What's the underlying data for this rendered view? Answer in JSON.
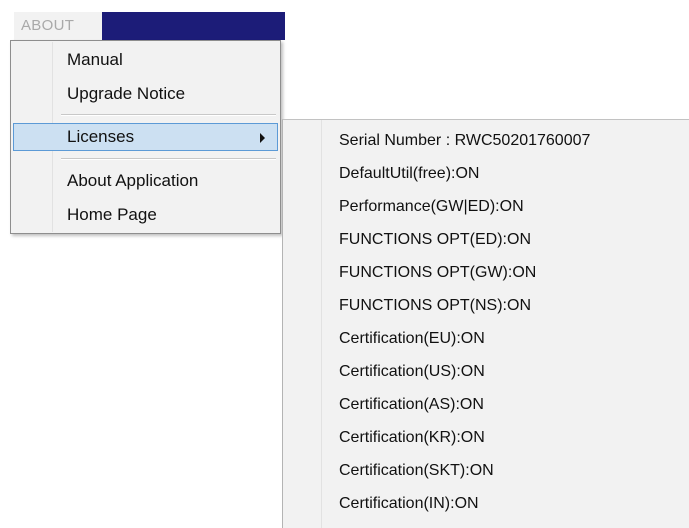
{
  "menubar": {
    "title": "ABOUT"
  },
  "menu": {
    "items": [
      {
        "label": "Manual"
      },
      {
        "label": "Upgrade Notice"
      },
      {
        "label": "Licenses"
      },
      {
        "label": "About Application"
      },
      {
        "label": "Home Page"
      }
    ],
    "submenu_arrow_icon": "triangle-right-icon"
  },
  "licenses_submenu": {
    "items": [
      {
        "label": "Serial Number : RWC50201760007"
      },
      {
        "label": "DefaultUtil(free):ON"
      },
      {
        "label": "Performance(GW|ED):ON"
      },
      {
        "label": "FUNCTIONS OPT(ED):ON"
      },
      {
        "label": "FUNCTIONS OPT(GW):ON"
      },
      {
        "label": "FUNCTIONS OPT(NS):ON"
      },
      {
        "label": "Certification(EU):ON"
      },
      {
        "label": "Certification(US):ON"
      },
      {
        "label": "Certification(AS):ON"
      },
      {
        "label": "Certification(KR):ON"
      },
      {
        "label": "Certification(SKT):ON"
      },
      {
        "label": "Certification(IN):ON"
      }
    ]
  },
  "colors": {
    "menubar_bg": "#1c1c78",
    "highlight_bg": "#cce0f2",
    "highlight_border": "#5c9ad6",
    "menu_bg": "#f2f2f2"
  }
}
